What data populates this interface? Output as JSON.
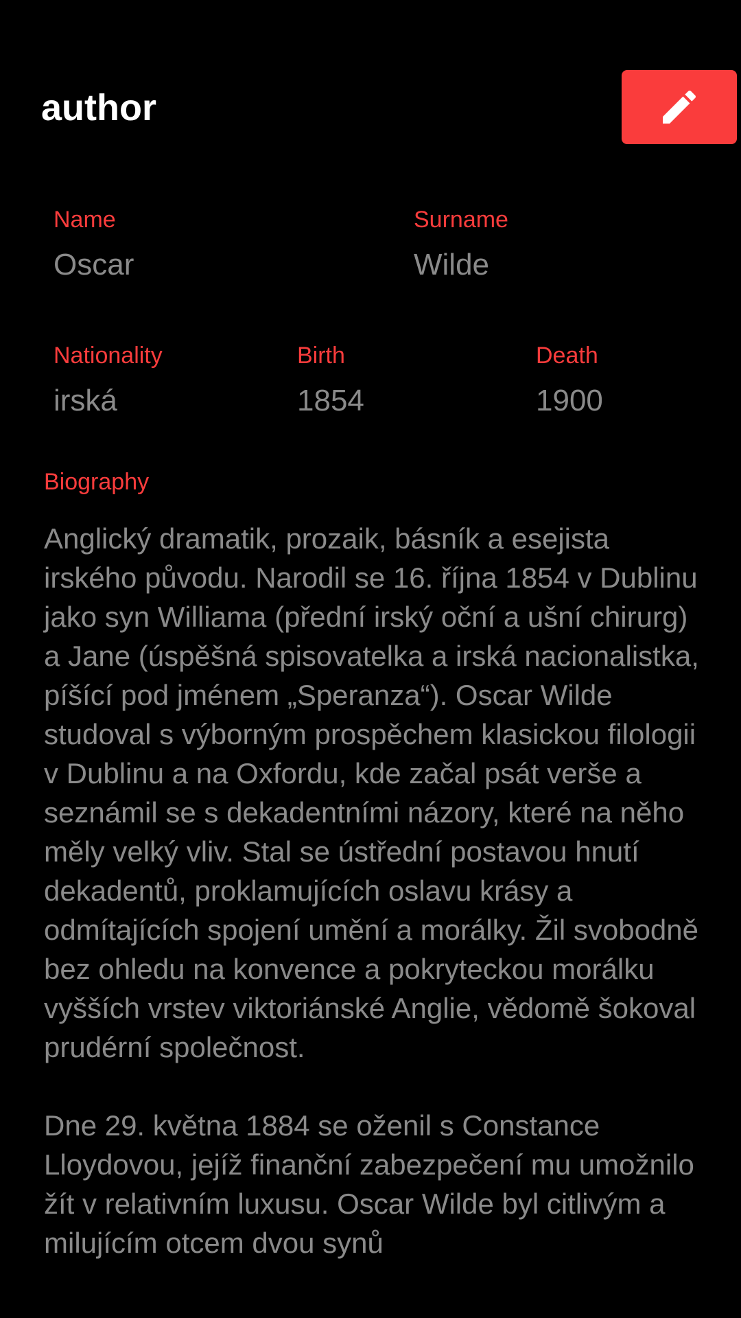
{
  "header": {
    "title": "author",
    "edit_icon": "pencil-icon"
  },
  "fields": {
    "name": {
      "label": "Name",
      "value": "Oscar"
    },
    "surname": {
      "label": "Surname",
      "value": "Wilde"
    },
    "nationality": {
      "label": "Nationality",
      "value": "irská"
    },
    "birth": {
      "label": "Birth",
      "value": "1854"
    },
    "death": {
      "label": "Death",
      "value": "1900"
    }
  },
  "biography": {
    "label": "Biography",
    "paragraphs": [
      "Anglický dramatik, prozaik, básník a esejista irského původu. Narodil se 16. října 1854 v Dublinu jako syn Williama (přední irský oční a ušní chirurg) a Jane (úspěšná spisovatelka a irská nacionalistka, píšící pod jménem „Speranza“). Oscar Wilde studoval s výborným prospěchem klasickou filologii v Dublinu a na Oxfordu, kde začal psát verše a seznámil se s dekadentními názory, které na něho měly velký vliv. Stal se ústřední postavou hnutí dekadentů, proklamujících oslavu krásy a odmítajících spojení umění a morálky. Žil svobodně bez ohledu na konvence a pokryteckou morálku vyšších vrstev viktoriánské Anglie, vědomě šokoval prudérní společnost.",
      "Dne 29. května 1884 se oženil s Constance Lloydovou, jejíž finanční zabezpečení mu umožnilo žít v relativním luxusu. Oscar Wilde byl citlivým a milujícím otcem dvou synů"
    ]
  },
  "colors": {
    "accent": "#fa3c3c",
    "background": "#000000",
    "value_text": "#8a8a8a"
  }
}
